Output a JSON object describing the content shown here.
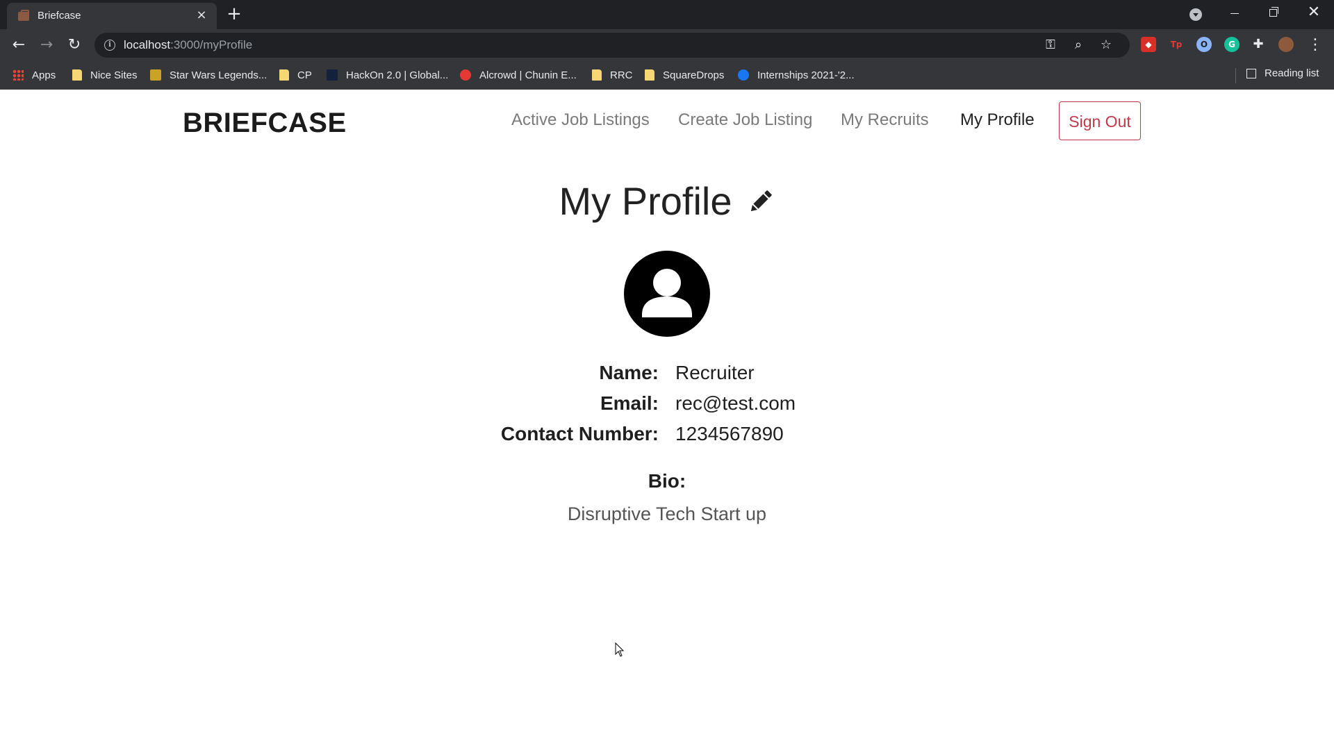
{
  "browser": {
    "tab_title": "Briefcase",
    "url_host": "localhost",
    "url_path": ":3000/myProfile",
    "bookmarks": [
      {
        "label": "Apps"
      },
      {
        "label": "Nice Sites"
      },
      {
        "label": "Star Wars Legends..."
      },
      {
        "label": "CP"
      },
      {
        "label": "HackOn 2.0 | Global..."
      },
      {
        "label": "Alcrowd | Chunin E..."
      },
      {
        "label": "RRC"
      },
      {
        "label": "SquareDrops"
      },
      {
        "label": "Internships 2021-'2..."
      }
    ],
    "reading_list": "Reading list"
  },
  "nav": {
    "brand": "BRIEFCASE",
    "links": [
      {
        "label": "Active Job Listings"
      },
      {
        "label": "Create Job Listing"
      },
      {
        "label": "My Recruits"
      },
      {
        "label": "My Profile"
      }
    ],
    "signout": "Sign Out"
  },
  "profile": {
    "title": "My Profile",
    "fields": [
      {
        "label": "Name:",
        "value": "Recruiter"
      },
      {
        "label": "Email:",
        "value": "rec@test.com"
      },
      {
        "label": "Contact Number:",
        "value": "1234567890"
      }
    ],
    "bio_label": "Bio:",
    "bio": "Disruptive Tech Start up"
  },
  "icons": {
    "edit": "pencil-icon",
    "avatar": "user-circle-icon"
  },
  "colors": {
    "signout_accent": "#c0394b",
    "active_nav": "#222222",
    "inactive_nav": "#7a7a7a"
  }
}
